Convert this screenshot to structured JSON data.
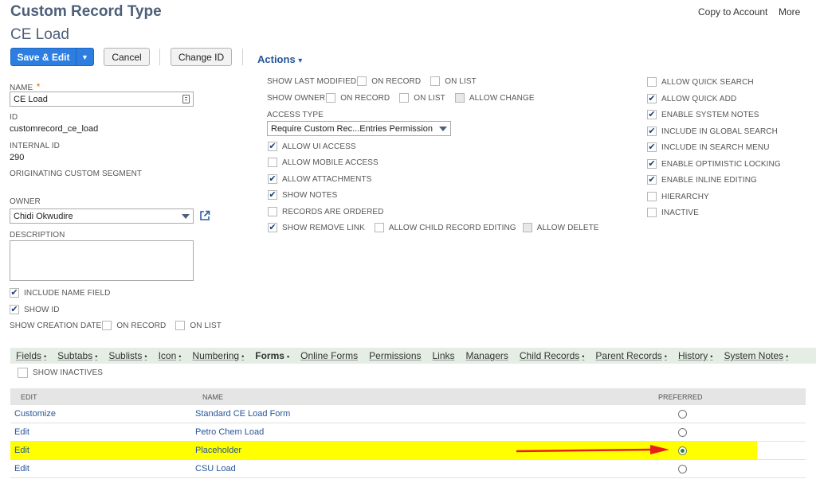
{
  "header": {
    "record_type": "Custom Record Type",
    "record_name": "CE Load",
    "links": {
      "copy_to_account": "Copy to Account",
      "more": "More"
    }
  },
  "toolbar": {
    "save_edit": "Save & Edit",
    "split_caret": "▼",
    "cancel": "Cancel",
    "change_id": "Change ID",
    "actions": "Actions",
    "actions_caret": "▾"
  },
  "left": {
    "name_label": "NAME",
    "required_mark": "*",
    "name_value": "CE Load",
    "id_label": "ID",
    "id_value": "customrecord_ce_load",
    "internal_id_label": "INTERNAL ID",
    "internal_id_value": "290",
    "originating_label": "ORIGINATING CUSTOM SEGMENT",
    "owner_label": "OWNER",
    "owner_value": "Chidi Okwudire",
    "description_label": "DESCRIPTION",
    "include_name_field": "INCLUDE NAME FIELD",
    "show_id": "SHOW ID",
    "show_creation_date": "SHOW CREATION DATE",
    "on_record": "ON RECORD",
    "on_list": "ON LIST"
  },
  "middle": {
    "show_last_modified": "SHOW LAST MODIFIED",
    "show_owner": "SHOW OWNER",
    "on_record": "ON RECORD",
    "on_list": "ON LIST",
    "allow_change": "ALLOW CHANGE",
    "access_type_label": "ACCESS TYPE",
    "access_type_value": "Require Custom Rec...Entries Permission",
    "allow_ui_access": "ALLOW UI ACCESS",
    "allow_mobile_access": "ALLOW MOBILE ACCESS",
    "allow_attachments": "ALLOW ATTACHMENTS",
    "show_notes": "SHOW NOTES",
    "records_are_ordered": "RECORDS ARE ORDERED",
    "show_remove_link": "SHOW REMOVE LINK",
    "allow_child_record_editing": "ALLOW CHILD RECORD EDITING",
    "allow_delete": "ALLOW DELETE"
  },
  "right": {
    "allow_quick_search": "ALLOW QUICK SEARCH",
    "allow_quick_add": "ALLOW QUICK ADD",
    "enable_system_notes": "ENABLE SYSTEM NOTES",
    "include_in_global_search": "INCLUDE IN GLOBAL SEARCH",
    "include_in_search_menu": "INCLUDE IN SEARCH MENU",
    "enable_optimistic_locking": "ENABLE OPTIMISTIC LOCKING",
    "enable_inline_editing": "ENABLE INLINE EDITING",
    "hierarchy": "HIERARCHY",
    "inactive": "INACTIVE"
  },
  "check_mark": "✔",
  "tabs": {
    "dot": "•",
    "items": [
      {
        "label": "Fields",
        "dot": true
      },
      {
        "label": "Subtabs",
        "dot": true
      },
      {
        "label": "Sublists",
        "dot": true
      },
      {
        "label": "Icon",
        "dot": true
      },
      {
        "label": "Numbering",
        "dot": true
      },
      {
        "label": "Forms",
        "dot": true
      },
      {
        "label": "Online Forms",
        "dot": false
      },
      {
        "label": "Permissions",
        "dot": false
      },
      {
        "label": "Links",
        "dot": false
      },
      {
        "label": "Managers",
        "dot": false
      },
      {
        "label": "Child Records",
        "dot": true
      },
      {
        "label": "Parent Records",
        "dot": true
      },
      {
        "label": "History",
        "dot": true
      },
      {
        "label": "System Notes",
        "dot": true
      }
    ]
  },
  "forms": {
    "show_inactives": "SHOW INACTIVES",
    "columns": {
      "edit": "EDIT",
      "name": "NAME",
      "preferred": "PREFERRED"
    },
    "rows": [
      {
        "edit": "Customize",
        "name": "Standard CE Load Form"
      },
      {
        "edit": "Edit",
        "name": "Petro Chem Load"
      },
      {
        "edit": "Edit",
        "name": "Placeholder"
      },
      {
        "edit": "Edit",
        "name": "CSU Load"
      }
    ]
  },
  "colors": {
    "highlight": "#ffff00",
    "arrow": "#e8201c",
    "primary": "#2c7ee0"
  }
}
